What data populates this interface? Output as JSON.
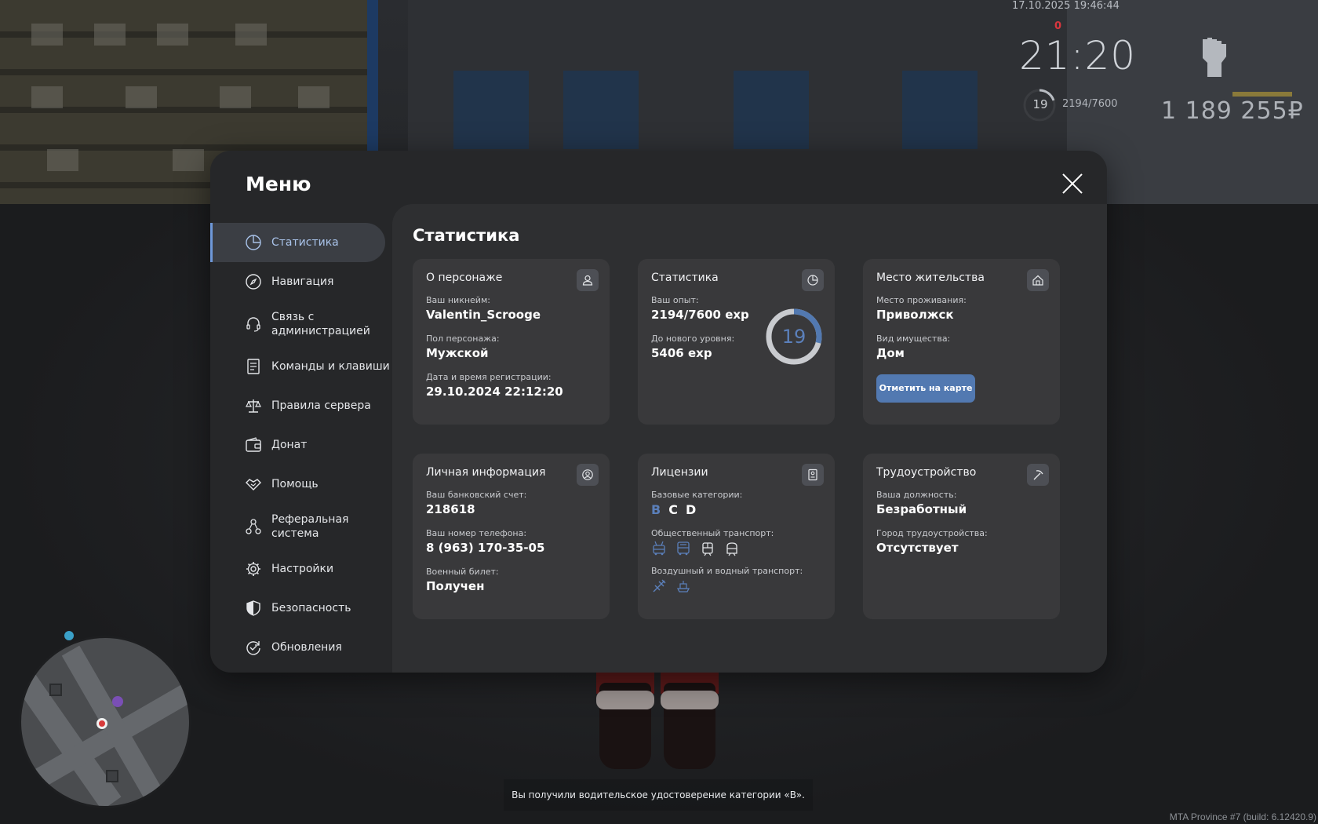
{
  "hud": {
    "date": "17.10.2025 19:46:44",
    "time": "21:20",
    "alert": "0",
    "level": "19",
    "exp": "2194/7600",
    "money": "1 189 255₽",
    "notice": "Вы получили водительское удостоверение категории «B».",
    "build": "MTA Province #7 (build: 6.12420.9)"
  },
  "menu": {
    "title": "Меню",
    "sidebar": [
      {
        "label": "Статистика",
        "icon": "pie-chart-icon"
      },
      {
        "label": "Навигация",
        "icon": "compass-icon"
      },
      {
        "label": "Связь с администрацией",
        "icon": "headset-icon"
      },
      {
        "label": "Команды и клавиши",
        "icon": "document-list-icon"
      },
      {
        "label": "Правила сервера",
        "icon": "scales-icon"
      },
      {
        "label": "Донат",
        "icon": "wallet-icon"
      },
      {
        "label": "Помощь",
        "icon": "handshake-icon"
      },
      {
        "label": "Реферальная система",
        "icon": "referral-nodes-icon"
      },
      {
        "label": "Настройки",
        "icon": "gear-icon"
      },
      {
        "label": "Безопасность",
        "icon": "shield-icon"
      },
      {
        "label": "Обновления",
        "icon": "refresh-check-icon"
      }
    ],
    "content_title": "Статистика",
    "character": {
      "title": "О персонаже",
      "nick_label": "Ваш никнейм:",
      "nick": "Valentin_Scrooge",
      "gender_label": "Пол персонажа:",
      "gender": "Мужской",
      "reg_label": "Дата и время регистрации:",
      "reg": "29.10.2024 22:12:20"
    },
    "stats": {
      "title": "Статистика",
      "exp_label": "Ваш опыт:",
      "exp": "2194/7600 exp",
      "next_label": "До нового уровня:",
      "next": "5406 exp",
      "level": "19",
      "progress": 0.289
    },
    "residence": {
      "title": "Место жительства",
      "place_label": "Место проживания:",
      "place": "Приволжск",
      "property_label": "Вид имущества:",
      "property": "Дом",
      "button": "Отметить на карте"
    },
    "personal": {
      "title": "Личная информация",
      "bank_label": "Ваш банковский счет:",
      "bank": "218618",
      "phone_label": "Ваш номер телефона:",
      "phone": "8 (963) 170-35-05",
      "military_label": "Военный билет:",
      "military": "Получен"
    },
    "licenses": {
      "title": "Лицензии",
      "basic_label": "Базовые категории:",
      "categories": [
        "B",
        "C",
        "D"
      ],
      "public_label": "Общественный транспорт:",
      "air_label": "Воздушный и водный транспорт:"
    },
    "job": {
      "title": "Трудоустройство",
      "position_label": "Ваша должность:",
      "position": "Безработный",
      "city_label": "Город трудоустройства:",
      "city": "Отсутствует"
    }
  },
  "colors": {
    "accent": "#5279b1",
    "active_text": "#a9c3ea",
    "license_b": "#5b80bb"
  }
}
